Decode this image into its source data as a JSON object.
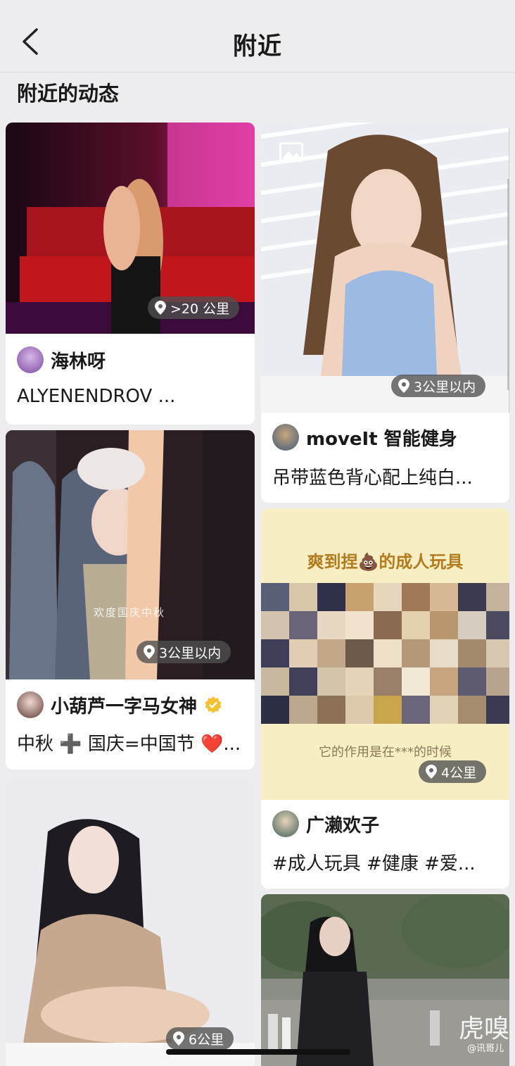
{
  "header": {
    "title": "附近"
  },
  "section_title": "附近的动态",
  "cards": [
    {
      "distance": ">20 公里",
      "author": "海林呀",
      "caption": "ALYENENDROV ..."
    },
    {
      "distance": "3公里以内",
      "author": "moveIt 智能健身",
      "caption": "吊带蓝色背心配上纯白..."
    },
    {
      "distance": "3公里以内",
      "author": "小葫芦一字马女神",
      "caption": "中秋 ➕ 国庆=中国节 ❤️...",
      "overlay_text": "欢度国庆中秋"
    },
    {
      "distance": "4公里",
      "author": "广濑欢子",
      "caption": "#成人玩具 #健康 #爱...",
      "banner_title": "爽到捏💩的成人玩具",
      "banner_sub": "它的作用是在***的时候"
    },
    {
      "distance": "6公里"
    },
    {}
  ],
  "watermark": {
    "brand": "虎嗅",
    "handle": "@讯哥儿"
  },
  "colors": {
    "background": "#ededef",
    "card": "#ffffff",
    "verified": "#f2c230"
  }
}
